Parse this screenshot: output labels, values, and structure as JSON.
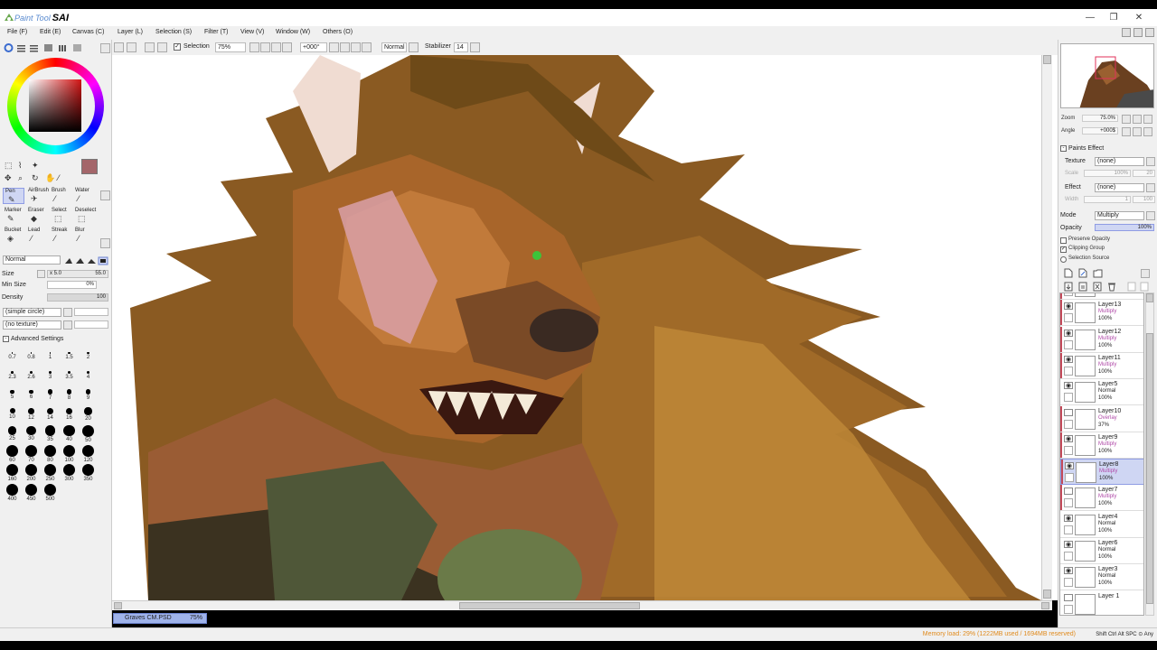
{
  "app": {
    "title_prefix": "Paint Tool",
    "title_name": "SAI",
    "window_controls": [
      "—",
      "❐",
      "✕"
    ]
  },
  "menu": [
    {
      "label": "File (F)"
    },
    {
      "label": "Edit (E)"
    },
    {
      "label": "Canvas (C)"
    },
    {
      "label": "Layer (L)"
    },
    {
      "label": "Selection (S)"
    },
    {
      "label": "Filter (T)"
    },
    {
      "label": "View (V)"
    },
    {
      "label": "Window (W)"
    },
    {
      "label": "Others (O)"
    }
  ],
  "toolbar": {
    "selection_label": "Selection",
    "selection_checked": true,
    "zoom_value": "75%",
    "rotation_value": "+000°",
    "blend_mode": "Normal",
    "stabilizer_label": "Stabilizer",
    "stabilizer_value": "14"
  },
  "color": {
    "foreground": "#a4666a",
    "background": "#f5d9a5"
  },
  "tools": [
    {
      "label": "Pen",
      "glyph": "✎",
      "selected": true
    },
    {
      "label": "AirBrush",
      "glyph": "✈",
      "selected": false
    },
    {
      "label": "Brush",
      "glyph": "⁄",
      "selected": false
    },
    {
      "label": "Water",
      "glyph": "⁄",
      "selected": false
    },
    {
      "label": "Marker",
      "glyph": "✎",
      "selected": false
    },
    {
      "label": "Eraser",
      "glyph": "◆",
      "selected": false
    },
    {
      "label": "Select",
      "glyph": "⬚",
      "selected": false
    },
    {
      "label": "Deselect",
      "glyph": "⬚",
      "selected": false
    },
    {
      "label": "Bucket",
      "glyph": "◈",
      "selected": false
    },
    {
      "label": "Lead",
      "glyph": "⁄",
      "selected": false
    },
    {
      "label": "Streak",
      "glyph": "⁄",
      "selected": false
    },
    {
      "label": "Blur",
      "glyph": "⁄",
      "selected": false
    }
  ],
  "brush": {
    "mode": "Normal",
    "size_label": "Size",
    "size_multiplier": "x 5.0",
    "size_value": "55.0",
    "min_size_label": "Min Size",
    "min_size_value": "0%",
    "density_label": "Density",
    "density_value": "100",
    "shape": "(simple circle)",
    "texture": "(no texture)",
    "advanced_label": "Advanced Settings"
  },
  "brush_sizes": [
    "0.7",
    "0.8",
    "1",
    "1.5",
    "2",
    "2.3",
    "2.6",
    "3",
    "3.5",
    "4",
    "5",
    "6",
    "7",
    "8",
    "9",
    "10",
    "12",
    "14",
    "16",
    "20",
    "25",
    "30",
    "35",
    "40",
    "50",
    "60",
    "70",
    "80",
    "100",
    "120",
    "160",
    "200",
    "250",
    "300",
    "350",
    "400",
    "450",
    "500"
  ],
  "document": {
    "tab_name": "Graves CM.PSD",
    "tab_zoom": "75%"
  },
  "status": {
    "memory": "Memory load: 29% (1222MB used / 1694MB reserved)",
    "keys": "Shift Ctrl Alt SPC ⊙ Any"
  },
  "navigator": {
    "zoom_label": "Zoom",
    "zoom_value": "75.0%",
    "angle_label": "Angle",
    "angle_value": "+000$"
  },
  "paints_effect": {
    "header": "Paints Effect",
    "texture_label": "Texture",
    "texture_value": "(none)",
    "scale_label": "Scale",
    "scale_value": "100%",
    "strength_label": "Strength",
    "strength_value": "20",
    "effect_label": "Effect",
    "effect_value": "(none)",
    "width_label": "Width",
    "width_value": "1",
    "width_max": "100"
  },
  "layer_props": {
    "mode_label": "Mode",
    "mode_value": "Multiply",
    "opacity_label": "Opacity",
    "opacity_value": "100%",
    "preserve_opacity": "Preserve Opacity",
    "clipping_group": "Clipping Group",
    "selection_source": "Selection Source",
    "clipping_checked": true
  },
  "layers": [
    {
      "name": "",
      "mode": "Overlay",
      "opacity": "100%",
      "clip": true,
      "visible": false,
      "selected": false,
      "mode_color": "#b04aa8"
    },
    {
      "name": "Layer13",
      "mode": "Multiply",
      "opacity": "100%",
      "clip": true,
      "visible": true,
      "selected": false,
      "mode_color": "#b04aa8"
    },
    {
      "name": "Layer12",
      "mode": "Multiply",
      "opacity": "100%",
      "clip": true,
      "visible": true,
      "selected": false,
      "mode_color": "#b04aa8"
    },
    {
      "name": "Layer11",
      "mode": "Multiply",
      "opacity": "100%",
      "clip": true,
      "visible": true,
      "selected": false,
      "mode_color": "#b04aa8"
    },
    {
      "name": "Layer5",
      "mode": "Normal",
      "opacity": "100%",
      "clip": false,
      "visible": true,
      "selected": false,
      "mode_color": "#222222"
    },
    {
      "name": "Layer10",
      "mode": "Overlay",
      "opacity": "37%",
      "clip": true,
      "visible": false,
      "selected": false,
      "mode_color": "#b04aa8"
    },
    {
      "name": "Layer9",
      "mode": "Multiply",
      "opacity": "100%",
      "clip": true,
      "visible": true,
      "selected": false,
      "mode_color": "#b04aa8"
    },
    {
      "name": "Layer8",
      "mode": "Multiply",
      "opacity": "100%",
      "clip": true,
      "visible": true,
      "selected": true,
      "mode_color": "#b04aa8"
    },
    {
      "name": "Layer7",
      "mode": "Multiply",
      "opacity": "100%",
      "clip": true,
      "visible": false,
      "selected": false,
      "mode_color": "#b04aa8"
    },
    {
      "name": "Layer4",
      "mode": "Normal",
      "opacity": "100%",
      "clip": false,
      "visible": true,
      "selected": false,
      "mode_color": "#222222"
    },
    {
      "name": "Layer6",
      "mode": "Normal",
      "opacity": "100%",
      "clip": false,
      "visible": true,
      "selected": false,
      "mode_color": "#222222"
    },
    {
      "name": "Layer3",
      "mode": "Normal",
      "opacity": "100%",
      "clip": false,
      "visible": true,
      "selected": false,
      "mode_color": "#222222"
    },
    {
      "name": "Layer 1",
      "mode": "",
      "opacity": "",
      "clip": false,
      "visible": false,
      "selected": false,
      "mode_color": "#222222"
    }
  ]
}
